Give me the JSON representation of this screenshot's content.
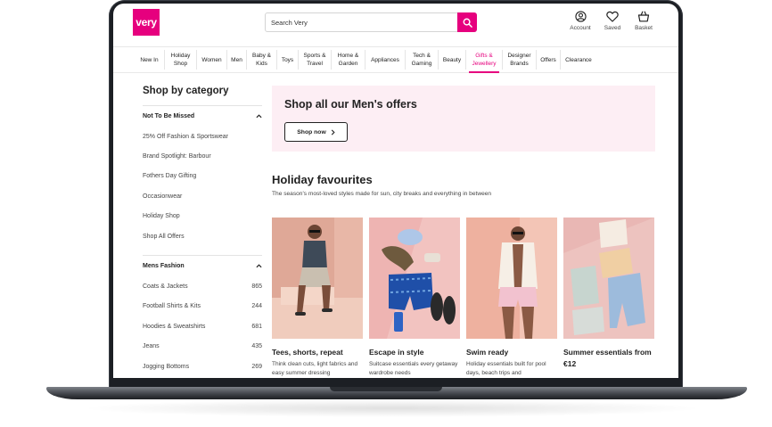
{
  "brand": {
    "logo_text": "very",
    "accent": "#e6007e"
  },
  "header": {
    "search_placeholder": "Search Very",
    "actions": [
      {
        "label": "Account",
        "icon": "account-icon"
      },
      {
        "label": "Saved",
        "icon": "heart-icon"
      },
      {
        "label": "Basket",
        "icon": "basket-icon"
      }
    ]
  },
  "nav": {
    "items": [
      {
        "label": "New In"
      },
      {
        "label": "Holiday Shop"
      },
      {
        "label": "Women"
      },
      {
        "label": "Men"
      },
      {
        "label": "Baby & Kids"
      },
      {
        "label": "Toys"
      },
      {
        "label": "Sports & Travel"
      },
      {
        "label": "Home & Garden"
      },
      {
        "label": "Appliances"
      },
      {
        "label": "Tech & Gaming"
      },
      {
        "label": "Beauty"
      },
      {
        "label": "Gifts & Jewellery",
        "active": true
      },
      {
        "label": "Designer Brands"
      },
      {
        "label": "Offers"
      },
      {
        "label": "Clearance"
      }
    ]
  },
  "sidebar": {
    "title": "Shop by category",
    "sections": [
      {
        "heading": "Not To Be Missed",
        "links": [
          {
            "label": "25% Off Fashion & Sportswear",
            "count": ""
          },
          {
            "label": "Brand Spotlight: Barbour",
            "count": ""
          },
          {
            "label": "Fothers Day Gifting",
            "count": ""
          },
          {
            "label": "Occasionwear",
            "count": ""
          },
          {
            "label": "Holiday Shop",
            "count": ""
          },
          {
            "label": "Shop All Offers",
            "count": ""
          }
        ]
      },
      {
        "heading": "Mens Fashion",
        "links": [
          {
            "label": "Coats & Jackets",
            "count": "865"
          },
          {
            "label": "Football Shirts & Kits",
            "count": "244"
          },
          {
            "label": "Hoodies & Sweatshirts",
            "count": "681"
          },
          {
            "label": "Jeans",
            "count": "435"
          },
          {
            "label": "Jogging Bottoms",
            "count": "269"
          }
        ]
      }
    ]
  },
  "promo": {
    "title": "Shop all our Men's offers",
    "button": "Shop now"
  },
  "section": {
    "title": "Holiday favourites",
    "subtitle": "The season's most-loved styles made for sun, city breaks and everything in between"
  },
  "cards": [
    {
      "title": "Tees, shorts, repeat",
      "desc": "Think clean cuts, light fabrics and easy summer dressing"
    },
    {
      "title": "Escape in style",
      "desc": "Suitcase essentials every getaway wardrobe needs"
    },
    {
      "title": "Swim ready",
      "desc": "Holiday essentials built for pool days, beach trips and"
    },
    {
      "title": "Summer essentials from €12",
      "desc": ""
    }
  ]
}
